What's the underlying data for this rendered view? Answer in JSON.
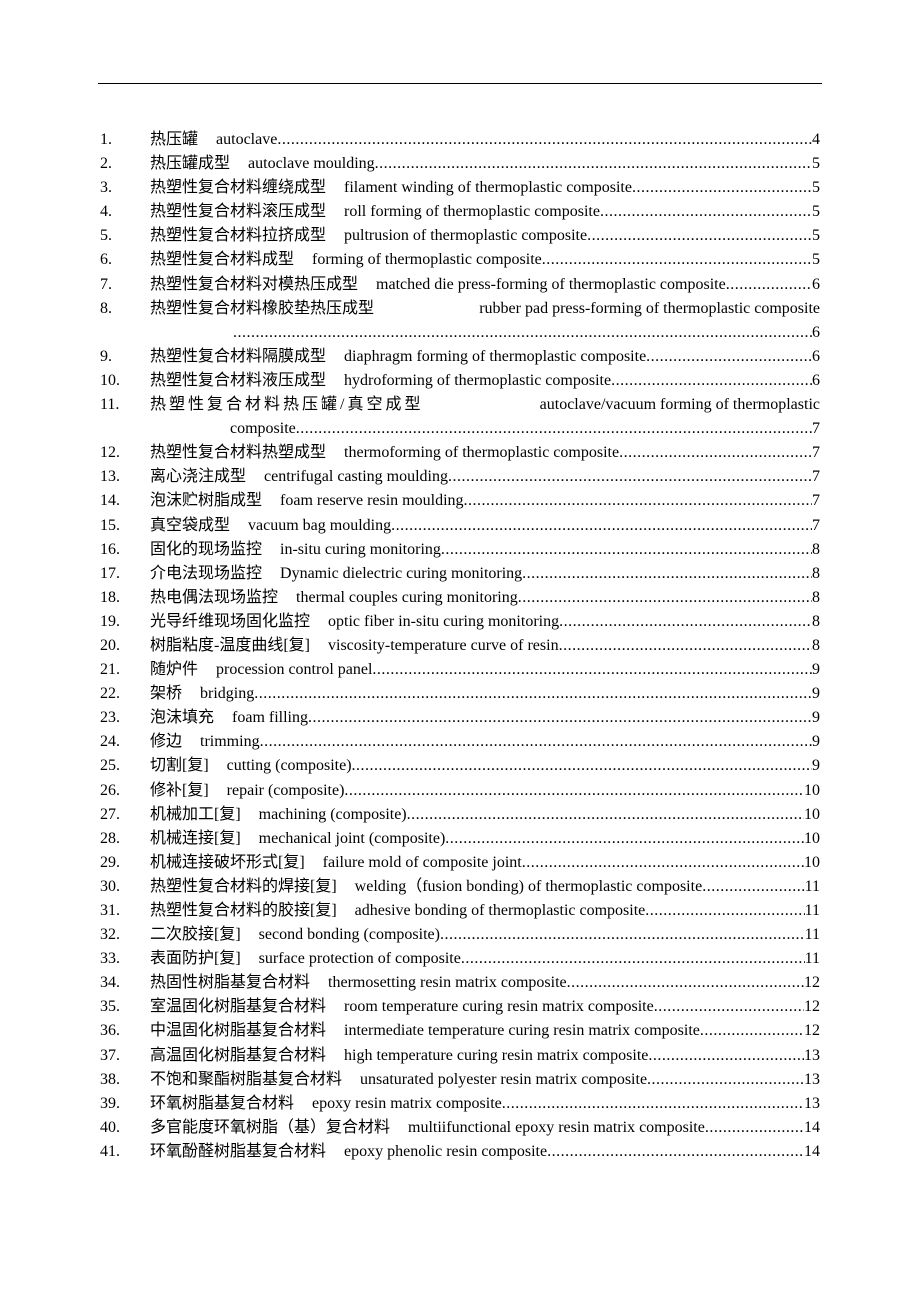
{
  "entries": [
    {
      "num": "1.",
      "zh": "热压罐",
      "en": "autoclave",
      "page": "4"
    },
    {
      "num": "2.",
      "zh": "热压罐成型",
      "en": "autoclave moulding",
      "page": "5"
    },
    {
      "num": "3.",
      "zh": "热塑性复合材料缠绕成型",
      "en": "filament winding of thermoplastic composite",
      "page": "5"
    },
    {
      "num": "4.",
      "zh": "热塑性复合材料滚压成型",
      "en": "roll forming of thermoplastic composite",
      "page": "5"
    },
    {
      "num": "5.",
      "zh": "热塑性复合材料拉挤成型",
      "en": "pultrusion of thermoplastic composite",
      "page": "5"
    },
    {
      "num": "6.",
      "zh": "热塑性复合材料成型",
      "en": "forming of thermoplastic composite",
      "page": "5"
    },
    {
      "num": "7.",
      "zh": "热塑性复合材料对模热压成型",
      "en": "matched die press-forming of thermoplastic composite",
      "page": "6"
    },
    {
      "num": "8.",
      "zh": "热塑性复合材料橡胶垫热压成型",
      "en": "rubber pad press-forming of thermoplastic composite",
      "cont": "",
      "page": "6"
    },
    {
      "num": "9.",
      "zh": "热塑性复合材料隔膜成型",
      "en": "diaphragm forming of thermoplastic composite",
      "page": "6"
    },
    {
      "num": "10.",
      "zh": "热塑性复合材料液压成型",
      "en": "hydroforming of thermoplastic composite",
      "page": "6"
    },
    {
      "num": "11.",
      "zh": "热塑性复合材料热压罐/真空成型",
      "en": "autoclave/vacuum forming of thermoplastic",
      "cont": "composite",
      "page": "7"
    },
    {
      "num": "12.",
      "zh": "热塑性复合材料热塑成型",
      "en": "thermoforming of thermoplastic composite",
      "page": "7"
    },
    {
      "num": "13.",
      "zh": "离心浇注成型",
      "en": "centrifugal casting moulding",
      "page": "7"
    },
    {
      "num": "14.",
      "zh": "泡沫贮树脂成型",
      "en": "foam reserve resin moulding",
      "page": "7"
    },
    {
      "num": "15.",
      "zh": "真空袋成型",
      "en": "vacuum bag moulding",
      "page": "7"
    },
    {
      "num": "16.",
      "zh": "固化的现场监控",
      "en": "in-situ curing monitoring",
      "page": "8"
    },
    {
      "num": "17.",
      "zh": "介电法现场监控",
      "en": "Dynamic dielectric curing monitoring",
      "page": "8"
    },
    {
      "num": "18.",
      "zh": "热电偶法现场监控",
      "en": "thermal couples curing monitoring",
      "page": "8"
    },
    {
      "num": "19.",
      "zh": "光导纤维现场固化监控",
      "en": "optic fiber in-situ curing monitoring",
      "page": "8"
    },
    {
      "num": "20.",
      "zh": "树脂粘度-温度曲线[复]",
      "en": "viscosity-temperature curve of resin",
      "page": "8"
    },
    {
      "num": "21.",
      "zh": "随炉件",
      "en": "procession control panel",
      "page": "9"
    },
    {
      "num": "22.",
      "zh": "架桥",
      "en": "bridging",
      "page": "9"
    },
    {
      "num": "23.",
      "zh": "泡沫填充",
      "en": "foam filling",
      "page": "9"
    },
    {
      "num": "24.",
      "zh": "修边",
      "en": "trimming",
      "page": "9"
    },
    {
      "num": "25.",
      "zh": "切割[复]",
      "en": "cutting (composite)",
      "page": "9"
    },
    {
      "num": "26.",
      "zh": "修补[复]",
      "en": "repair (composite)",
      "page": "10"
    },
    {
      "num": "27.",
      "zh": "机械加工[复]",
      "en": "machining (composite)",
      "page": "10"
    },
    {
      "num": "28.",
      "zh": "机械连接[复]",
      "en": "mechanical joint (composite)",
      "page": "10"
    },
    {
      "num": "29.",
      "zh": "机械连接破坏形式[复]",
      "en": "failure mold of composite joint",
      "page": "10"
    },
    {
      "num": "30.",
      "zh": "热塑性复合材料的焊接[复]",
      "en": "welding（fusion bonding) of thermoplastic composite",
      "page": "11"
    },
    {
      "num": "31.",
      "zh": "热塑性复合材料的胶接[复]",
      "en": "adhesive bonding of thermoplastic composite",
      "page": "11"
    },
    {
      "num": "32.",
      "zh": "二次胶接[复]",
      "en": "second bonding (composite)",
      "page": "11"
    },
    {
      "num": "33.",
      "zh": "表面防护[复]",
      "en": "surface protection of composite",
      "page": "11"
    },
    {
      "num": "34.",
      "zh": "热固性树脂基复合材料",
      "en": "thermosetting resin matrix composite",
      "page": "12"
    },
    {
      "num": "35.",
      "zh": "室温固化树脂基复合材料",
      "en": "room temperature curing resin matrix composite",
      "page": "12"
    },
    {
      "num": "36.",
      "zh": "中温固化树脂基复合材料",
      "en": "intermediate temperature curing resin matrix composite",
      "page": "12"
    },
    {
      "num": "37.",
      "zh": "高温固化树脂基复合材料",
      "en": "high temperature curing resin matrix composite",
      "page": "13"
    },
    {
      "num": "38.",
      "zh": "不饱和聚酯树脂基复合材料",
      "en": "unsaturated polyester resin matrix composite",
      "page": "13"
    },
    {
      "num": "39.",
      "zh": "环氧树脂基复合材料",
      "en": "epoxy resin matrix composite",
      "page": "13"
    },
    {
      "num": "40.",
      "zh": "多官能度环氧树脂（基）复合材料",
      "en": "multiifunctional epoxy resin matrix composite",
      "page": "14"
    },
    {
      "num": "41.",
      "zh": "环氧酚醛树脂基复合材料",
      "en": "epoxy phenolic resin composite",
      "page": "14"
    }
  ]
}
